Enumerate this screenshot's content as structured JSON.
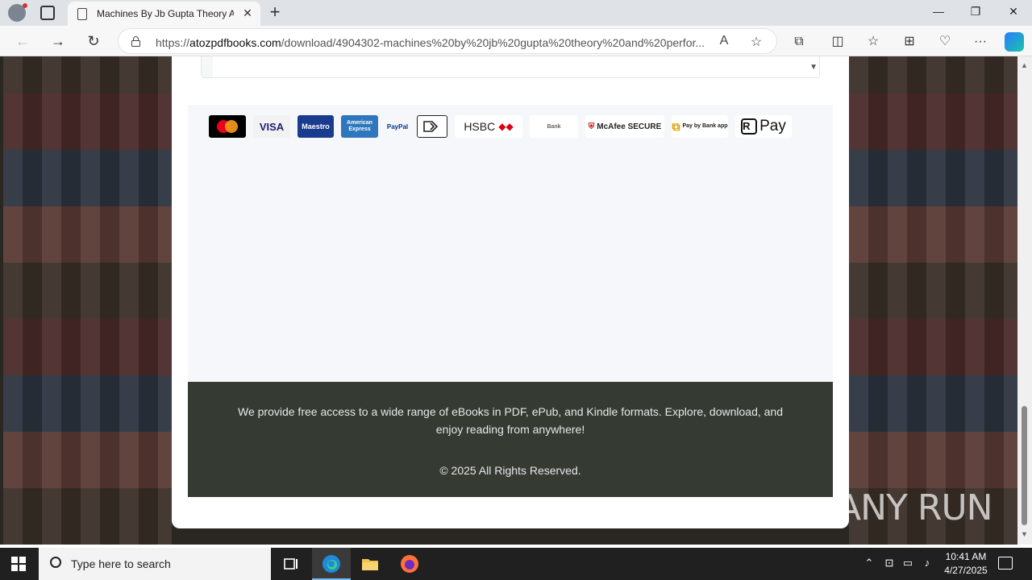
{
  "browser": {
    "tab_title": "Machines By Jb Gupta Theory An",
    "url_domain": "atozpdfbooks.com",
    "url_prefix": "https://",
    "url_path": "/download/4904302-machines%20by%20jb%20gupta%20theory%20and%20perfor...",
    "icons": [
      "profile-icon",
      "tab-actions-icon",
      "page-icon",
      "close-tab-icon",
      "new-tab-icon",
      "minimize-icon",
      "restore-icon",
      "close-window-icon",
      "back-icon",
      "forward-icon",
      "refresh-icon",
      "lock-icon",
      "read-aloud-icon",
      "favorite-star-icon",
      "extensions-icon",
      "split-screen-icon",
      "favorites-icon",
      "collections-icon",
      "performance-icon",
      "more-icon",
      "copilot-icon"
    ]
  },
  "page": {
    "payment_methods": [
      "Mastercard",
      "VISA",
      "Maestro",
      "American Express",
      "PayPal",
      "Skrill",
      "HSBC",
      "Bank",
      "McAfee SECURE",
      "Pay by Bank app",
      "Pay"
    ],
    "footer_text": "We provide free access to a wide range of eBooks in PDF, ePub, and Kindle formats. Explore, download, and enjoy reading from anywhere!",
    "footer_copy": "© 2025 All Rights Reserved."
  },
  "watermark": "ANY RUN",
  "taskbar": {
    "search_placeholder": "Type here to search",
    "time": "10:41 AM",
    "date": "4/27/2025"
  },
  "colors": {
    "footer_bg": "#353a33",
    "mastercard": "#000000",
    "maestro": "#1a3c8f",
    "amex": "#2e77bc"
  }
}
